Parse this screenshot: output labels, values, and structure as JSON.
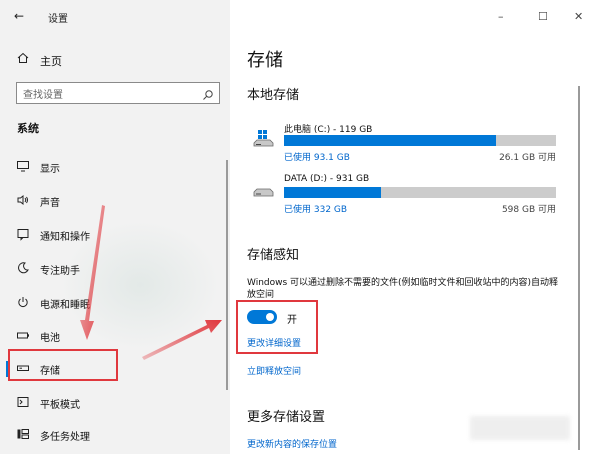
{
  "sidebar": {
    "title": "设置",
    "home_label": "主页",
    "search_placeholder": "查找设置",
    "section_title": "系统",
    "items": [
      {
        "label": "显示",
        "icon": "display-icon"
      },
      {
        "label": "声音",
        "icon": "speaker-icon"
      },
      {
        "label": "通知和操作",
        "icon": "notification-icon"
      },
      {
        "label": "专注助手",
        "icon": "moon-icon"
      },
      {
        "label": "电源和睡眠",
        "icon": "power-icon"
      },
      {
        "label": "电池",
        "icon": "battery-icon"
      },
      {
        "label": "存储",
        "icon": "storage-icon"
      },
      {
        "label": "平板模式",
        "icon": "tablet-icon"
      },
      {
        "label": "多任务处理",
        "icon": "multitask-icon"
      }
    ],
    "active_index": 6
  },
  "main": {
    "title": "存储",
    "local_storage_heading": "本地存储",
    "drives": [
      {
        "name": "此电脑 (C:) - 119 GB",
        "used": "已使用 93.1 GB",
        "free": "26.1 GB 可用",
        "used_fraction": 0.78,
        "icon": "windows-drive-icon"
      },
      {
        "name": "DATA (D:) - 931 GB",
        "used": "已使用 332 GB",
        "free": "598 GB 可用",
        "used_fraction": 0.357,
        "icon": "hard-drive-icon"
      }
    ],
    "storage_sense_heading": "存储感知",
    "storage_sense_desc": "Windows 可以通过删除不需要的文件(例如临时文件和回收站中的内容)自动释放空间",
    "toggle_label": "开",
    "toggle_on": true,
    "link_change_settings": "更改详细设置",
    "link_free_now": "立即释放空间",
    "more_heading": "更多存储设置",
    "link_save_location": "更改新内容的保存位置"
  },
  "colors": {
    "accent": "#0078d7",
    "annotation": "#e0383e",
    "link": "#0066cc"
  }
}
